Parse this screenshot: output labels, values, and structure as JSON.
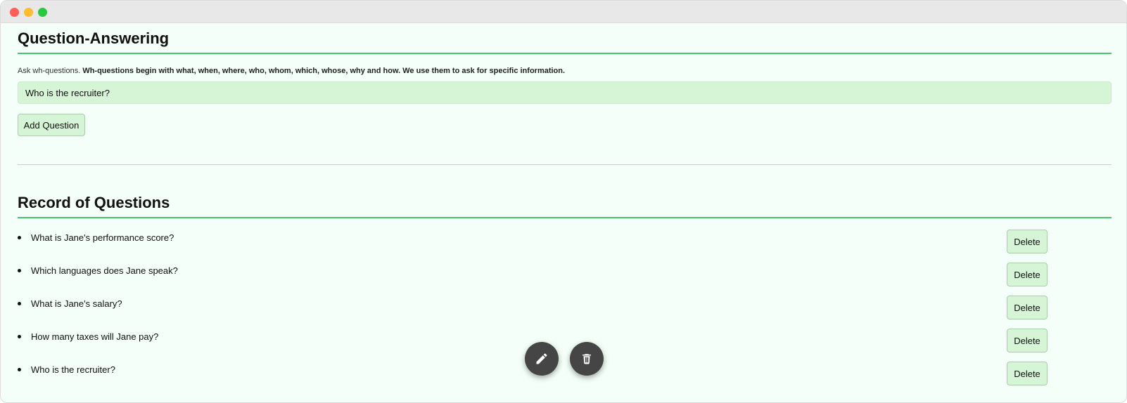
{
  "window": {
    "controls": [
      "close",
      "minimize",
      "maximize"
    ]
  },
  "qa": {
    "title": "Question-Answering",
    "hint_prefix": "Ask wh-questions.",
    "hint_bold": "Wh-questions begin with what, when, where, who, whom, which, whose, why and how. We use them to ask for specific information.",
    "input_value": "Who is the recruiter?",
    "add_button_label": "Add Question"
  },
  "record": {
    "title": "Record of Questions",
    "delete_label": "Delete",
    "questions": [
      {
        "text": "What is Jane's performance score?"
      },
      {
        "text": "Which languages does Jane speak?"
      },
      {
        "text": "What is Jane's salary?"
      },
      {
        "text": "How many taxes will Jane pay?"
      },
      {
        "text": "Who is the recruiter?"
      }
    ]
  },
  "fabs": {
    "edit_icon": "pencil-icon",
    "delete_icon": "trash-icon"
  },
  "colors": {
    "accent_green": "#42c56b",
    "input_bg": "#d6f4d6",
    "page_bg": "#f3fff8",
    "fab_bg": "#454545"
  }
}
